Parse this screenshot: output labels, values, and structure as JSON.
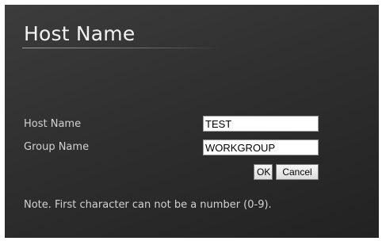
{
  "page": {
    "title": "Host Name"
  },
  "form": {
    "host_name_label": "Host Name",
    "host_name_value": "TEST",
    "group_name_label": "Group Name",
    "group_name_value": "WORKGROUP",
    "ok_label": "OK",
    "cancel_label": "Cancel"
  },
  "note": "Note. First character can not be a number (0-9)."
}
